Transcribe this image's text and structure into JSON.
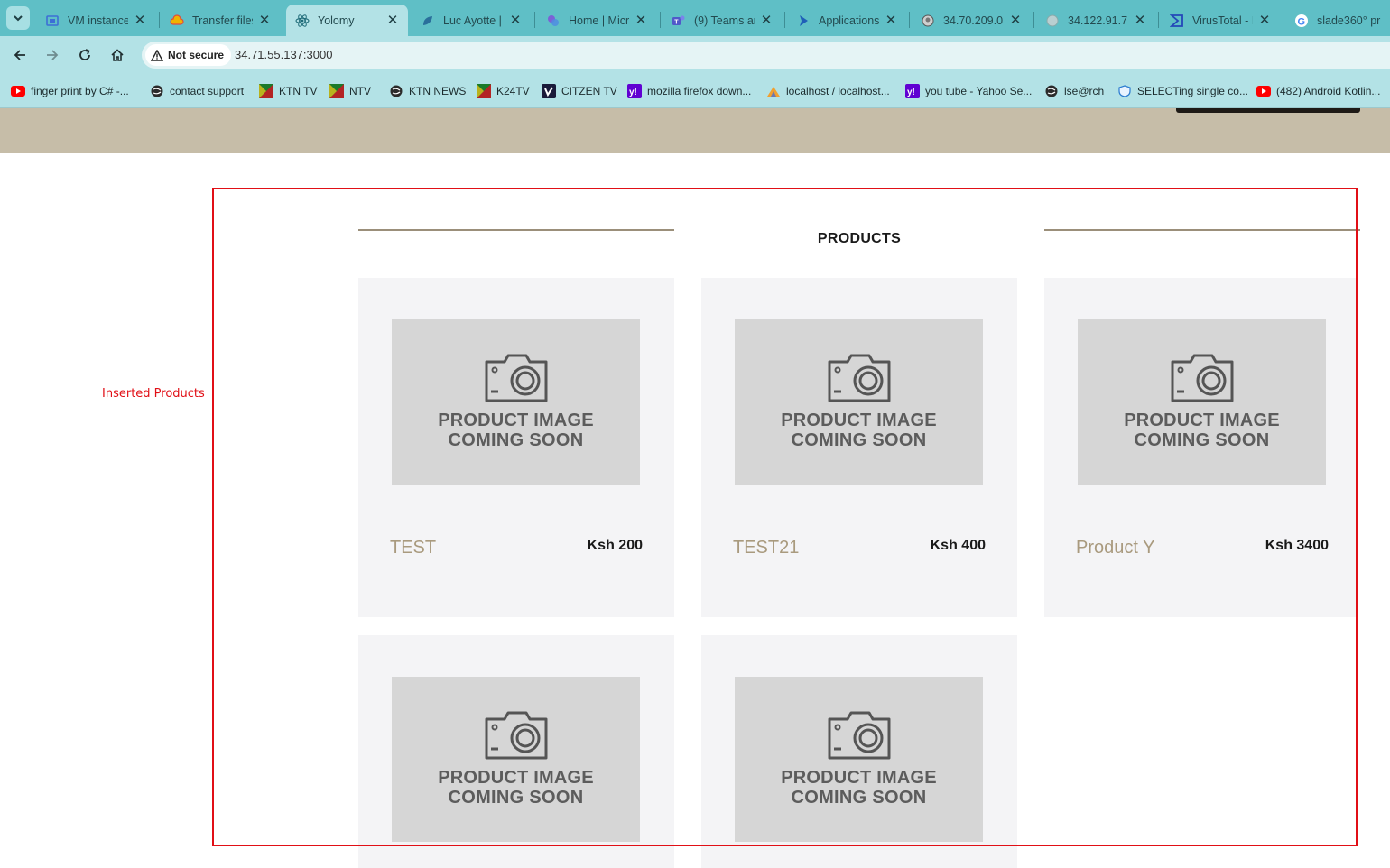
{
  "browser": {
    "tabs": [
      {
        "title": "VM instance",
        "icon": "vm-icon",
        "active": false
      },
      {
        "title": "Transfer files",
        "icon": "cloud-icon",
        "active": false
      },
      {
        "title": "Yolomy",
        "icon": "react-icon",
        "active": true
      },
      {
        "title": "Luc Ayotte |",
        "icon": "leaf-icon",
        "active": false
      },
      {
        "title": "Home | Micr",
        "icon": "microsoft-icon",
        "active": false
      },
      {
        "title": "(9) Teams an",
        "icon": "teams-icon",
        "active": false
      },
      {
        "title": "Applications",
        "icon": "azure-icon",
        "active": false
      },
      {
        "title": "34.70.209.0",
        "icon": "globe-icon",
        "active": false
      },
      {
        "title": "34.122.91.7",
        "icon": "globe-icon",
        "active": false
      },
      {
        "title": "VirusTotal - I",
        "icon": "virustotal-icon",
        "active": false
      },
      {
        "title": "slade360° pr",
        "icon": "google-icon",
        "active": false
      }
    ],
    "security_label": "Not secure",
    "url": "34.71.55.137:3000",
    "bookmarks": [
      {
        "label": "finger print by C# -...",
        "icon": "youtube-icon"
      },
      {
        "label": "contact support",
        "icon": "globe-icon"
      },
      {
        "label": "KTN TV",
        "icon": "tv-icon"
      },
      {
        "label": "NTV",
        "icon": "tv-icon"
      },
      {
        "label": "KTN NEWS",
        "icon": "globe-icon"
      },
      {
        "label": "K24TV",
        "icon": "tv-icon"
      },
      {
        "label": "CITZEN TV",
        "icon": "vimeo-icon"
      },
      {
        "label": "mozilla firefox down...",
        "icon": "yahoo-icon"
      },
      {
        "label": "localhost / localhost...",
        "icon": "phpmyadmin-icon"
      },
      {
        "label": "you tube - Yahoo Se...",
        "icon": "yahoo-icon"
      },
      {
        "label": "lse@rch",
        "icon": "globe-icon"
      },
      {
        "label": "SELECTing single co...",
        "icon": "shield-icon"
      },
      {
        "label": "(482) Android Kotlin...",
        "icon": "youtube-icon"
      }
    ]
  },
  "page": {
    "section_title": "PRODUCTS",
    "annotation_label": "Inserted Products",
    "placeholder": {
      "line1": "PRODUCT IMAGE",
      "line2": "COMING SOON"
    },
    "products": [
      {
        "name": "TEST",
        "price": "Ksh 200"
      },
      {
        "name": "TEST21",
        "price": "Ksh 400"
      },
      {
        "name": "Product Y",
        "price": "Ksh 3400"
      },
      {
        "name": "",
        "price": ""
      },
      {
        "name": "",
        "price": ""
      }
    ]
  }
}
